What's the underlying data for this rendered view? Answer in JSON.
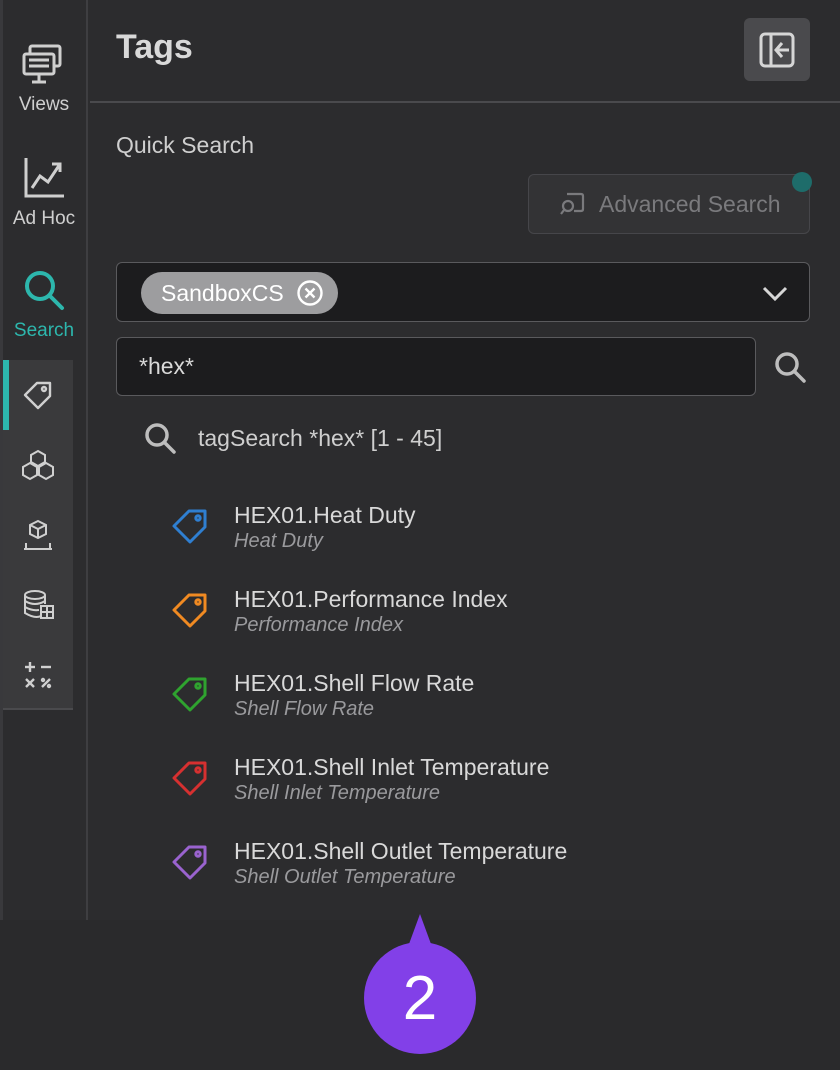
{
  "nav": {
    "views_label": "Views",
    "adhoc_label": "Ad Hoc",
    "search_label": "Search",
    "active": "search"
  },
  "subnav": [
    {
      "icon": "tag-icon",
      "active": true
    },
    {
      "icon": "cubes-icon",
      "active": false
    },
    {
      "icon": "asset-icon",
      "active": false
    },
    {
      "icon": "database-icon",
      "active": false
    },
    {
      "icon": "calculator-icon",
      "active": false
    }
  ],
  "header": {
    "title": "Tags"
  },
  "search": {
    "quick_label": "Quick Search",
    "advanced_label": "Advanced Search",
    "scope_chip": "SandboxCS",
    "query": "*hex*",
    "result_summary": "tagSearch *hex* [1 - 45]"
  },
  "tags": [
    {
      "name": "HEX01.Heat Duty",
      "description": "Heat Duty",
      "color": "#2f7fd1"
    },
    {
      "name": "HEX01.Performance Index",
      "description": "Performance Index",
      "color": "#f08a22"
    },
    {
      "name": "HEX01.Shell Flow Rate",
      "description": "Shell Flow Rate",
      "color": "#2fa32f"
    },
    {
      "name": "HEX01.Shell Inlet Temperature",
      "description": "Shell Inlet Temperature",
      "color": "#d63030"
    },
    {
      "name": "HEX01.Shell Outlet Temperature",
      "description": "Shell Outlet Temperature",
      "color": "#9a63cf"
    }
  ],
  "colors": {
    "accent": "#2db7ad",
    "step_badge": "#8240e8"
  },
  "step_badge": {
    "number": "2"
  }
}
